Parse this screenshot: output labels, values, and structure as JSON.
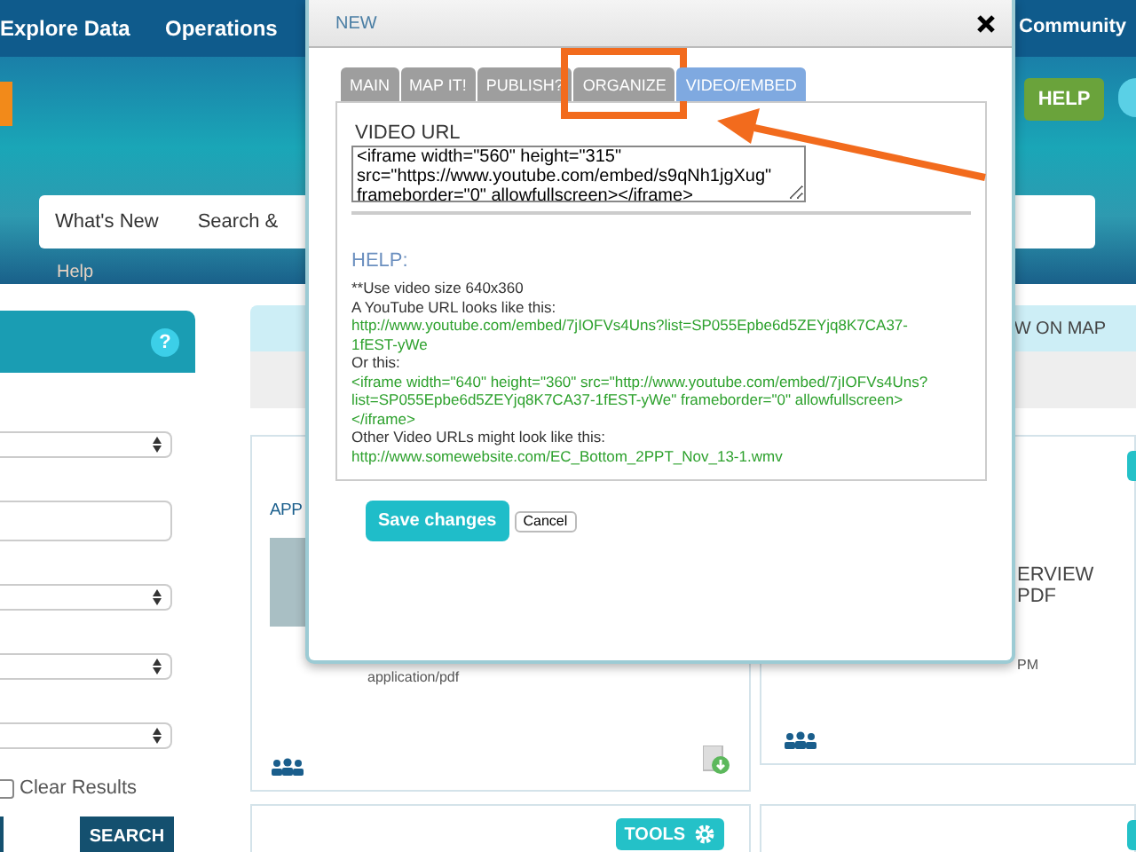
{
  "nav": {
    "items": [
      "Explore Data",
      "Operations",
      "Community"
    ]
  },
  "hero": {
    "help_button": "HELP",
    "search_tabs": [
      "What's New",
      "Search &"
    ],
    "help_link": "Help"
  },
  "left_panel": {
    "help_icon": "?",
    "fields": [
      {
        "kind": "select"
      },
      {
        "kind": "input"
      },
      {
        "kind": "select"
      },
      {
        "kind": "select"
      },
      {
        "kind": "select"
      }
    ],
    "clear_results": {
      "label": "Clear Results",
      "checked": false
    },
    "search_button": "SEARCH"
  },
  "results": {
    "header": "W ON MAP",
    "cards": [
      {
        "title": "APP",
        "meta": [
          "application/pdf"
        ],
        "has_thumbnail": true,
        "has_download": true
      },
      {
        "title": "ERVIEW PDF",
        "meta": [
          "PM"
        ],
        "has_thumbnail": false,
        "has_download": false
      }
    ],
    "tools_button": "TOOLS"
  },
  "modal": {
    "title": "NEW",
    "tabs": [
      {
        "label": "MAIN",
        "selected": false,
        "highlighted": false
      },
      {
        "label": "MAP IT!",
        "selected": false,
        "highlighted": false
      },
      {
        "label": "PUBLISH?",
        "selected": false,
        "highlighted": false
      },
      {
        "label": "ORGANIZE",
        "selected": false,
        "highlighted": true
      },
      {
        "label": "VIDEO/EMBED",
        "selected": true,
        "highlighted": false
      }
    ],
    "field_label": "VIDEO URL",
    "field_value": "<iframe width=\"560\" height=\"315\" src=\"https://www.youtube.com/embed/s9qNh1jgXug\" frameborder=\"0\" allowfullscreen></iframe>",
    "help_title": "HELP:",
    "help_lines": [
      {
        "kind": "note",
        "text": "**Use video size 640x360"
      },
      {
        "kind": "note",
        "text": "A YouTube URL looks like this:"
      },
      {
        "kind": "example",
        "text": "http://www.youtube.com/embed/7jIOFVs4Uns?list=SP055Epbe6d5ZEYjq8K7CA37-1fEST-yWe"
      },
      {
        "kind": "note",
        "text": "Or this:"
      },
      {
        "kind": "example",
        "text": "<iframe width=\"640\" height=\"360\" src=\"http://www.youtube.com/embed/7jIOFVs4Uns?list=SP055Epbe6d5ZEYjq8K7CA37-1fEST-yWe\" frameborder=\"0\" allowfullscreen></iframe>"
      },
      {
        "kind": "note",
        "text": "Other Video URLs might look like this:"
      },
      {
        "kind": "example",
        "text": "http://www.somewebsite.com/EC_Bottom_2PPT_Nov_13-1.wmv"
      }
    ],
    "save_button": "Save changes",
    "cancel_button": "Cancel"
  }
}
